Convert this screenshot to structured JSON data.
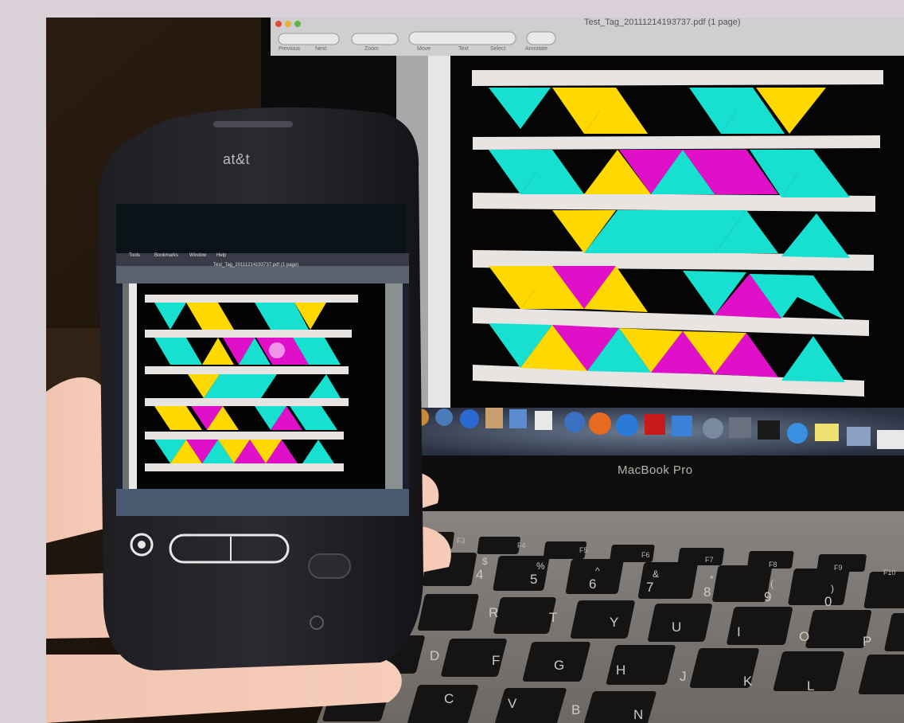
{
  "photo": {
    "description_free": true,
    "laptop": {
      "brand_label": "MacBook Pro",
      "window_title": "Test_Tag_20111214193737.pdf (1 page)",
      "toolbar": [
        "Previous",
        "Next",
        "Zoom",
        "Move",
        "Text",
        "Select",
        "Annotate"
      ],
      "keyboard": {
        "number_row": [
          [
            "$",
            "4"
          ],
          [
            "%",
            "5"
          ],
          [
            "^",
            "6"
          ],
          [
            "&",
            "7"
          ],
          [
            "*",
            "8"
          ],
          [
            "(",
            "9"
          ],
          [
            ")",
            "0"
          ]
        ],
        "top_row": [
          "R",
          "T",
          "Y",
          "U",
          "I",
          "O",
          "P"
        ],
        "home_row": [
          "D",
          "F",
          "G",
          "H",
          "J",
          "K",
          "L"
        ],
        "bottom_row": [
          "C",
          "V",
          "B",
          "N"
        ],
        "function_keys": [
          "F3",
          "F4",
          "F5",
          "F6",
          "F7",
          "F8",
          "F9",
          "F10"
        ]
      }
    },
    "phone": {
      "carrier_logo": "at&t",
      "window_title": "Test_Tag_20111214193737.pdf (1 page)",
      "menu": [
        "Tools",
        "Bookmarks",
        "Window",
        "Help"
      ]
    },
    "colors": {
      "cyan": "#18e0d0",
      "yellow": "#ffd800",
      "magenta": "#e010c8",
      "bar": "#e8e4e2",
      "screen_bg": "#030303"
    }
  }
}
